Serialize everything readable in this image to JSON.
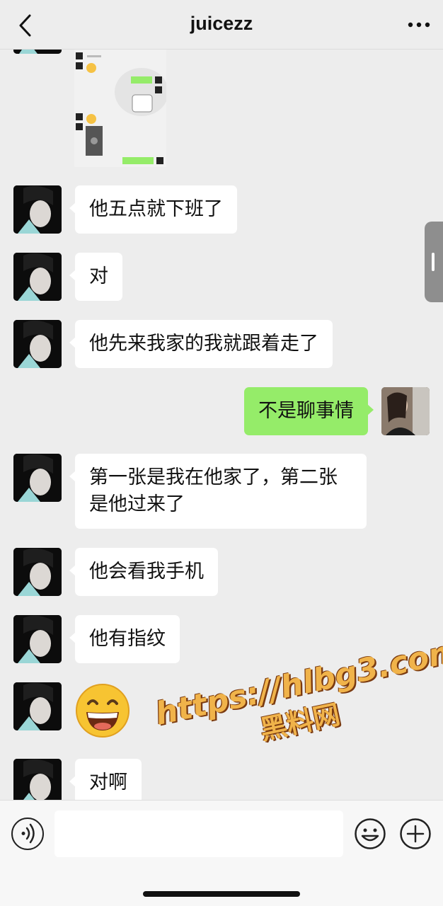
{
  "header": {
    "title": "juicezz",
    "back_icon": "chevron-left-icon",
    "more_icon": "more-dots-icon"
  },
  "messages": [
    {
      "side": "left",
      "type": "image"
    },
    {
      "side": "left",
      "type": "text",
      "text": "他五点就下班了"
    },
    {
      "side": "left",
      "type": "text",
      "text": "对"
    },
    {
      "side": "left",
      "type": "text",
      "text": "他先来我家的我就跟着走了"
    },
    {
      "side": "right",
      "type": "text",
      "text": "不是聊事情"
    },
    {
      "side": "left",
      "type": "text",
      "text": "第一张是我在他家了，第二张是他过来了"
    },
    {
      "side": "left",
      "type": "text",
      "text": "他会看我手机"
    },
    {
      "side": "left",
      "type": "text",
      "text": "他有指纹"
    },
    {
      "side": "left",
      "type": "emoji",
      "emoji": "grinning-face-icon"
    },
    {
      "side": "left",
      "type": "text",
      "text": "对啊"
    }
  ],
  "watermark": {
    "url": "https://hlbg3.com",
    "label": "黑料网"
  },
  "input_bar": {
    "voice_icon": "voice-icon",
    "emoji_icon": "smile-icon",
    "plus_icon": "plus-icon",
    "value": ""
  },
  "colors": {
    "background": "#ededed",
    "incoming_bubble": "#ffffff",
    "outgoing_bubble": "#95ec69",
    "watermark": "#f0b34a"
  }
}
